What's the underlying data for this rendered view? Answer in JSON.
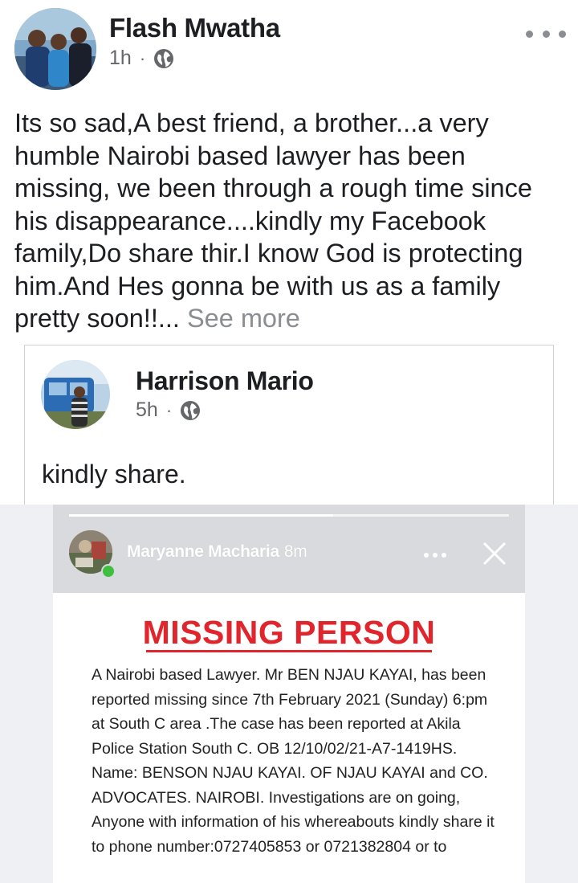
{
  "post": {
    "author": "Flash Mwatha",
    "time": "1h",
    "separator": "·",
    "text": "Its so sad,A best friend, a brother...a very humble Nairobi based lawyer has been missing, we been through a rough time since his disappearance....kindly my Facebook family,Do share thir.I know God is protecting him.And Hes gonna be with us as a family pretty soon!!... ",
    "see_more": "See more",
    "icons": {
      "more": "more-horizontal-icon",
      "audience": "globe-icon"
    }
  },
  "shared_post": {
    "author": "Harrison Mario",
    "time": "5h",
    "separator": "·",
    "text": "kindly share."
  },
  "story": {
    "user": "Maryanne Macharia",
    "time": "8m",
    "progress": 0.6,
    "icons": {
      "more": "more-horizontal-icon",
      "close": "close-icon"
    }
  },
  "flyer": {
    "title": "MISSING PERSON",
    "body": "A Nairobi based Lawyer. Mr BEN NJAU KAYAI, has been reported missing since 7th February 2021 (Sunday) 6:pm at South C area .The case has been reported at Akila Police Station South C. OB 12/10/02/21-A7-1419HS.  Name: BENSON NJAU KAYAI.   OF NJAU KAYAI and CO. ADVOCATES. NAIROBI. Investigations are on going, Anyone with information of his whereabouts kindly share it to phone number:0727405853 or 0721382804 or to"
  },
  "colors": {
    "text": "#1c1e21",
    "meta": "#65676b",
    "accent_red": "#e0262c",
    "online": "#3fbf3f"
  }
}
